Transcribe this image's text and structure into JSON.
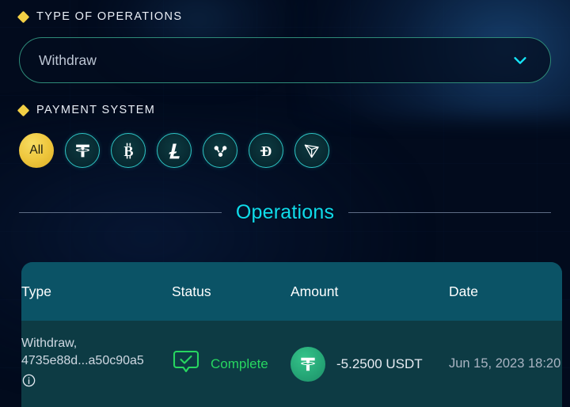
{
  "filters": {
    "type_of_operations": {
      "label": "TYPE OF OPERATIONS",
      "selected_value": "Withdraw",
      "chevron_icon": "chevron-down-icon",
      "bullet_icon": "diamond-bullet-icon"
    },
    "payment_system": {
      "label": "PAYMENT SYSTEM",
      "bullet_icon": "diamond-bullet-icon",
      "options": [
        {
          "id": "all",
          "label": "All",
          "icon": "all-filter-chip",
          "selected": true
        },
        {
          "id": "usdt",
          "label": "",
          "icon": "tether-icon",
          "selected": false
        },
        {
          "id": "btc",
          "label": "",
          "icon": "bitcoin-icon",
          "selected": false
        },
        {
          "id": "ltc",
          "label": "",
          "icon": "litecoin-icon",
          "selected": false
        },
        {
          "id": "xrp",
          "label": "",
          "icon": "ripple-icon",
          "selected": false
        },
        {
          "id": "doge",
          "label": "",
          "icon": "dogecoin-icon",
          "selected": false
        },
        {
          "id": "trx",
          "label": "",
          "icon": "tron-icon",
          "selected": false
        }
      ]
    }
  },
  "operations": {
    "title": "Operations",
    "columns": [
      "Type",
      "Status",
      "Amount",
      "Date"
    ],
    "rows": [
      {
        "type_primary": "Withdraw,",
        "type_secondary": "4735e88d...a50c90a5",
        "info_icon": "info-icon",
        "status": "Complete",
        "status_icon": "check-bubble-icon",
        "amount": "-5.2500 USDT",
        "amount_icon": "tether-icon",
        "date": "Jun 15, 2023 18:20"
      }
    ]
  },
  "colors": {
    "background": "#020b1d",
    "accent_cyan": "#0fdcea",
    "accent_yellow": "#eec63c",
    "border_teal": "#2e8a78",
    "status_green": "#27d660",
    "table_header": "#0b5366",
    "table_row": "#0d3b44"
  }
}
